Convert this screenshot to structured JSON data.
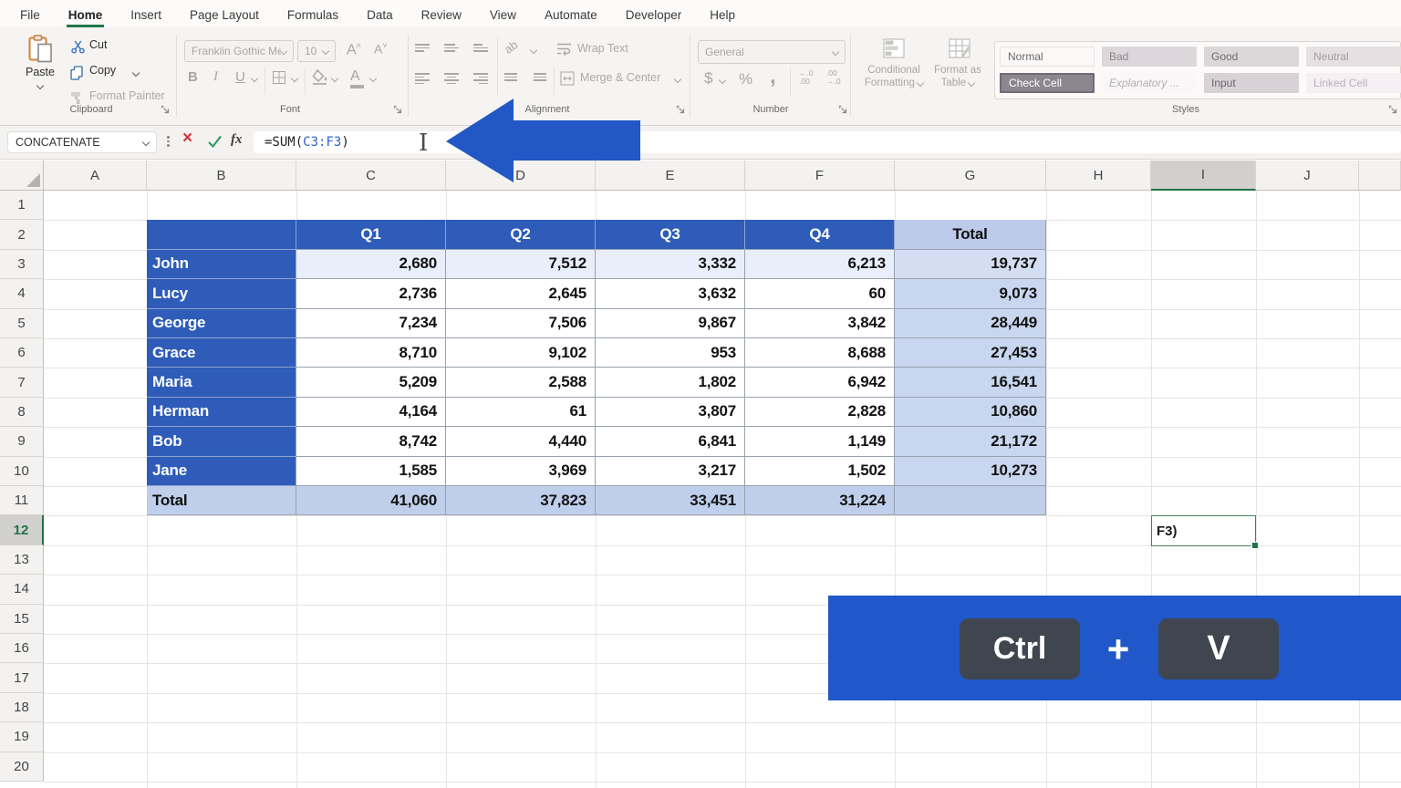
{
  "menu": {
    "tabs": [
      {
        "label": "File",
        "active": false
      },
      {
        "label": "Home",
        "active": true
      },
      {
        "label": "Insert",
        "active": false
      },
      {
        "label": "Page Layout",
        "active": false
      },
      {
        "label": "Formulas",
        "active": false
      },
      {
        "label": "Data",
        "active": false
      },
      {
        "label": "Review",
        "active": false
      },
      {
        "label": "View",
        "active": false
      },
      {
        "label": "Automate",
        "active": false
      },
      {
        "label": "Developer",
        "active": false
      },
      {
        "label": "Help",
        "active": false
      }
    ]
  },
  "ribbon": {
    "clipboard": {
      "label": "Clipboard",
      "paste": "Paste",
      "cut": "Cut",
      "copy": "Copy",
      "format_painter": "Format Painter"
    },
    "font": {
      "label": "Font",
      "font_name": "Franklin Gothic Med",
      "font_size": "10",
      "bold": "B",
      "italic": "I",
      "underline": "U"
    },
    "alignment": {
      "label": "Alignment",
      "orientation_glyph": "ab",
      "wrap_text": "Wrap Text",
      "merge_center": "Merge & Center"
    },
    "number": {
      "label": "Number",
      "format": "General",
      "currency": "$",
      "percent": "%",
      "comma": ","
    },
    "styles": {
      "label": "Styles",
      "conditional_formatting": "Conditional Formatting",
      "format_as_table": "Format as Table",
      "chips": [
        {
          "label": "Normal"
        },
        {
          "label": "Bad"
        },
        {
          "label": "Good"
        },
        {
          "label": "Neutral"
        },
        {
          "label": "Check Cell"
        },
        {
          "label": "Explanatory ..."
        },
        {
          "label": "Input"
        },
        {
          "label": "Linked Cell"
        }
      ]
    }
  },
  "formula_bar": {
    "name_box": "CONCATENATE",
    "fx_label": "fx",
    "formula": {
      "prefix": "=SUM(",
      "ref": "C3:F3",
      "suffix": ")"
    }
  },
  "sheet": {
    "columns": [
      "A",
      "B",
      "C",
      "D",
      "E",
      "F",
      "G",
      "H",
      "I",
      "J"
    ],
    "rows": [
      "1",
      "2",
      "3",
      "4",
      "5",
      "6",
      "7",
      "8",
      "9",
      "10",
      "11",
      "12",
      "13",
      "14",
      "15",
      "16",
      "17",
      "18",
      "19",
      "20"
    ],
    "active_column": "I",
    "active_row": "12",
    "edit_cell": {
      "ref": "I12",
      "value": "F3)"
    }
  },
  "table": {
    "headers": [
      "",
      "Q1",
      "Q2",
      "Q3",
      "Q4",
      "Total"
    ],
    "rows": [
      {
        "name": "John",
        "values": [
          "2,680",
          "7,512",
          "3,332",
          "6,213"
        ],
        "total": "19,737"
      },
      {
        "name": "Lucy",
        "values": [
          "2,736",
          "2,645",
          "3,632",
          "60"
        ],
        "total": "9,073"
      },
      {
        "name": "George",
        "values": [
          "7,234",
          "7,506",
          "9,867",
          "3,842"
        ],
        "total": "28,449"
      },
      {
        "name": "Grace",
        "values": [
          "8,710",
          "9,102",
          "953",
          "8,688"
        ],
        "total": "27,453"
      },
      {
        "name": "Maria",
        "values": [
          "5,209",
          "2,588",
          "1,802",
          "6,942"
        ],
        "total": "16,541"
      },
      {
        "name": "Herman",
        "values": [
          "4,164",
          "61",
          "3,807",
          "2,828"
        ],
        "total": "10,860"
      },
      {
        "name": "Bob",
        "values": [
          "8,742",
          "4,440",
          "6,841",
          "1,149"
        ],
        "total": "21,172"
      },
      {
        "name": "Jane",
        "values": [
          "1,585",
          "3,969",
          "3,217",
          "1,502"
        ],
        "total": "10,273"
      }
    ],
    "total_row": {
      "name": "Total",
      "values": [
        "41,060",
        "37,823",
        "33,451",
        "31,224"
      ],
      "total": ""
    }
  },
  "shortcut": {
    "keys": [
      "Ctrl",
      "V"
    ],
    "separator": "+"
  },
  "colors": {
    "table_header_blue": "#2e5cb8",
    "total_column_fill": "#c9d6ef",
    "total_row_fill": "#bfcfeb",
    "copied_row_fill": "#e9eefb",
    "banner_blue": "#2057c9",
    "key_background": "#3f4650",
    "arrow_blue": "#2158c6",
    "active_green": "#217346",
    "formula_ref_blue": "#2b62c9"
  }
}
